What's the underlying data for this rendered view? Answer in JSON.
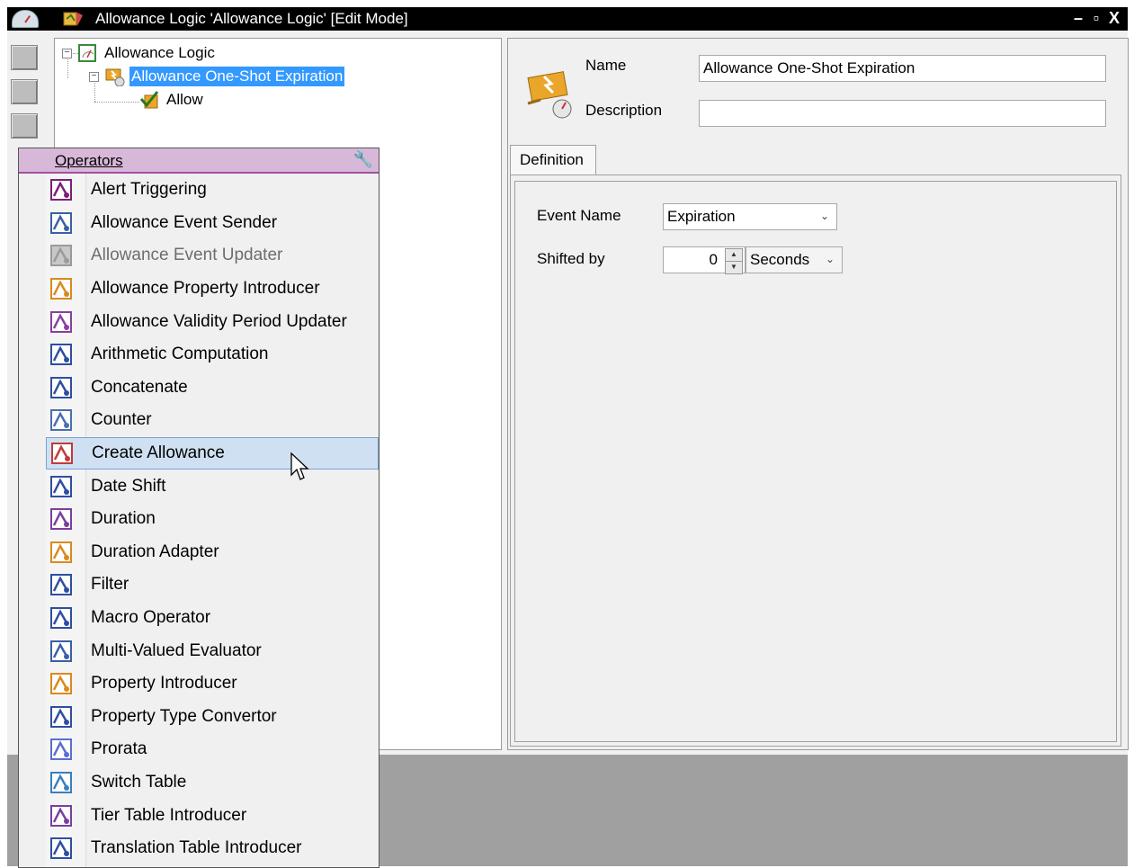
{
  "window": {
    "title": "Allowance Logic 'Allowance Logic' [Edit Mode]",
    "controls": {
      "minimize": "–",
      "restore": "▫",
      "close": "X"
    }
  },
  "tree": {
    "root": {
      "label": "Allowance Logic",
      "expander": "−"
    },
    "child": {
      "label": "Allowance One-Shot Expiration",
      "expander": "−",
      "selected": true
    },
    "leaf": {
      "label": "Allow"
    }
  },
  "details": {
    "name_label": "Name",
    "name_value": "Allowance One-Shot Expiration",
    "description_label": "Description",
    "description_value": "",
    "tab_label": "Definition",
    "event_name_label": "Event Name",
    "event_name_value": "Expiration",
    "shifted_by_label": "Shifted by",
    "shifted_by_value": "0",
    "shifted_unit": "Seconds"
  },
  "operators": {
    "title": "Operators",
    "items": [
      {
        "label": "Alert Triggering",
        "icon": "alert-triggering-icon",
        "color": "#7a1f7a"
      },
      {
        "label": "Allowance Event Sender",
        "icon": "event-sender-icon",
        "color": "#3a5fa8"
      },
      {
        "label": "Allowance Event Updater",
        "icon": "event-updater-icon",
        "color": "#9a9a9a",
        "disabled": true
      },
      {
        "label": "Allowance Property Introducer",
        "icon": "property-introducer-icon",
        "color": "#d98a1f"
      },
      {
        "label": "Allowance Validity Period Updater",
        "icon": "validity-period-icon",
        "color": "#8a3fa0"
      },
      {
        "label": "Arithmetic Computation",
        "icon": "arithmetic-icon",
        "color": "#2e4fa0"
      },
      {
        "label": "Concatenate",
        "icon": "concatenate-icon",
        "color": "#2e4fa0"
      },
      {
        "label": "Counter",
        "icon": "counter-icon",
        "color": "#4a6fb0"
      },
      {
        "label": "Create Allowance",
        "icon": "create-allowance-icon",
        "color": "#c23a3a",
        "hovered": true
      },
      {
        "label": "Date Shift",
        "icon": "date-shift-icon",
        "color": "#2e4fa0"
      },
      {
        "label": "Duration",
        "icon": "duration-icon",
        "color": "#7a3fa0"
      },
      {
        "label": "Duration Adapter",
        "icon": "duration-adapter-icon",
        "color": "#d98a1f"
      },
      {
        "label": "Filter",
        "icon": "filter-icon",
        "color": "#2e4fa0"
      },
      {
        "label": "Macro Operator",
        "icon": "macro-operator-icon",
        "color": "#2e4fa0"
      },
      {
        "label": "Multi-Valued Evaluator",
        "icon": "multi-valued-evaluator-icon",
        "color": "#3a5fa8"
      },
      {
        "label": "Property Introducer",
        "icon": "property-introducer-2-icon",
        "color": "#d98a1f"
      },
      {
        "label": "Property Type Convertor",
        "icon": "property-type-convertor-icon",
        "color": "#2e4fa0"
      },
      {
        "label": "Prorata",
        "icon": "prorata-icon",
        "color": "#5a6fd0"
      },
      {
        "label": "Switch Table",
        "icon": "switch-table-icon",
        "color": "#3a7fc0"
      },
      {
        "label": "Tier Table Introducer",
        "icon": "tier-table-icon",
        "color": "#7a3fa0"
      },
      {
        "label": "Translation Table Introducer",
        "icon": "translation-table-icon",
        "color": "#2e4fa0"
      }
    ]
  }
}
